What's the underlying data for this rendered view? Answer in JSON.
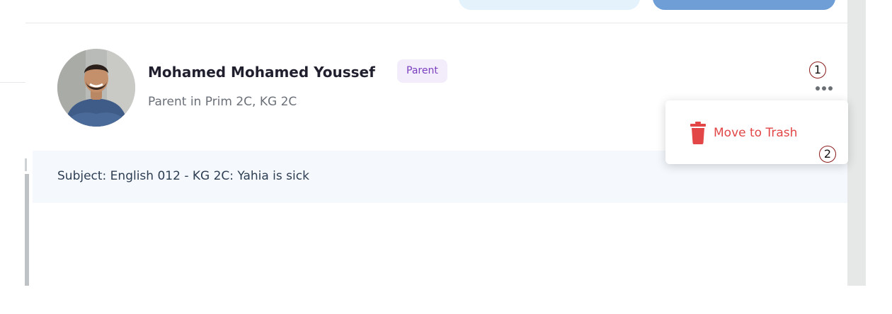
{
  "contact": {
    "name": "Mohamed Mohamed Youssef",
    "badge": "Parent",
    "subtitle": "Parent in Prim 2C, KG 2C"
  },
  "message": {
    "subject": "Subject: English 012 - KG 2C: Yahia is sick"
  },
  "menu": {
    "items": [
      {
        "label": "Move to Trash",
        "icon": "trash-icon"
      }
    ]
  },
  "markers": [
    "1",
    "2"
  ],
  "colors": {
    "primary_button": "#6f9ed6",
    "secondary_button": "#e4f2fc",
    "badge_bg": "#f3ecfb",
    "badge_text": "#7a3fbf",
    "danger": "#e24646",
    "subject_bg": "#f5f9fd"
  }
}
